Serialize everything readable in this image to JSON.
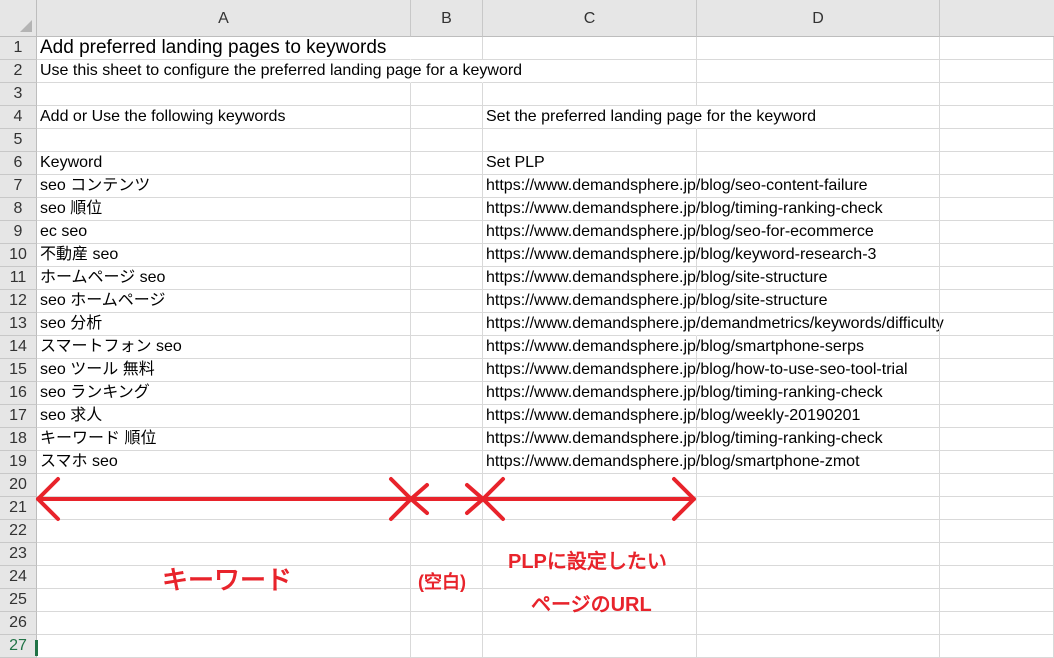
{
  "columns": [
    "A",
    "B",
    "C",
    "D"
  ],
  "rows": [
    {
      "num": "1",
      "a": "Add preferred landing pages to keywords",
      "c": ""
    },
    {
      "num": "2",
      "a": "Use this sheet to configure the preferred landing page for a keyword",
      "c": ""
    },
    {
      "num": "3",
      "a": "",
      "c": ""
    },
    {
      "num": "4",
      "a": "Add or Use the following keywords",
      "c": "Set the preferred landing page for the keyword"
    },
    {
      "num": "5",
      "a": "",
      "c": ""
    },
    {
      "num": "6",
      "a": "Keyword",
      "c": "Set PLP"
    },
    {
      "num": "7",
      "a": "seo コンテンツ",
      "c": "https://www.demandsphere.jp/blog/seo-content-failure"
    },
    {
      "num": "8",
      "a": "seo 順位",
      "c": "https://www.demandsphere.jp/blog/timing-ranking-check"
    },
    {
      "num": "9",
      "a": "ec seo",
      "c": "https://www.demandsphere.jp/blog/seo-for-ecommerce"
    },
    {
      "num": "10",
      "a": "不動産 seo",
      "c": "https://www.demandsphere.jp/blog/keyword-research-3"
    },
    {
      "num": "11",
      "a": "ホームページ seo",
      "c": "https://www.demandsphere.jp/blog/site-structure"
    },
    {
      "num": "12",
      "a": "seo ホームページ",
      "c": "https://www.demandsphere.jp/blog/site-structure"
    },
    {
      "num": "13",
      "a": "seo 分析",
      "c": "https://www.demandsphere.jp/demandmetrics/keywords/difficulty"
    },
    {
      "num": "14",
      "a": "スマートフォン seo",
      "c": "https://www.demandsphere.jp/blog/smartphone-serps"
    },
    {
      "num": "15",
      "a": "seo ツール 無料",
      "c": "https://www.demandsphere.jp/blog/how-to-use-seo-tool-trial"
    },
    {
      "num": "16",
      "a": "seo ランキング",
      "c": "https://www.demandsphere.jp/blog/timing-ranking-check"
    },
    {
      "num": "17",
      "a": "seo 求人",
      "c": "https://www.demandsphere.jp/blog/weekly-20190201"
    },
    {
      "num": "18",
      "a": "キーワード 順位",
      "c": "https://www.demandsphere.jp/blog/timing-ranking-check"
    },
    {
      "num": "19",
      "a": "スマホ seo",
      "c": "https://www.demandsphere.jp/blog/smartphone-zmot"
    },
    {
      "num": "20",
      "a": "",
      "c": ""
    },
    {
      "num": "21",
      "a": "",
      "c": ""
    },
    {
      "num": "22",
      "a": "",
      "c": ""
    },
    {
      "num": "23",
      "a": "",
      "c": ""
    },
    {
      "num": "24",
      "a": "",
      "c": ""
    },
    {
      "num": "25",
      "a": "",
      "c": ""
    },
    {
      "num": "26",
      "a": "",
      "c": ""
    },
    {
      "num": "27",
      "a": "",
      "c": ""
    }
  ],
  "annotations": {
    "keyword_label": "キーワード",
    "blank_label": "(空白)",
    "plp_label_line1": "PLPに設定したい",
    "plp_label_line2": "ページのURL",
    "color": "#e8232b"
  }
}
